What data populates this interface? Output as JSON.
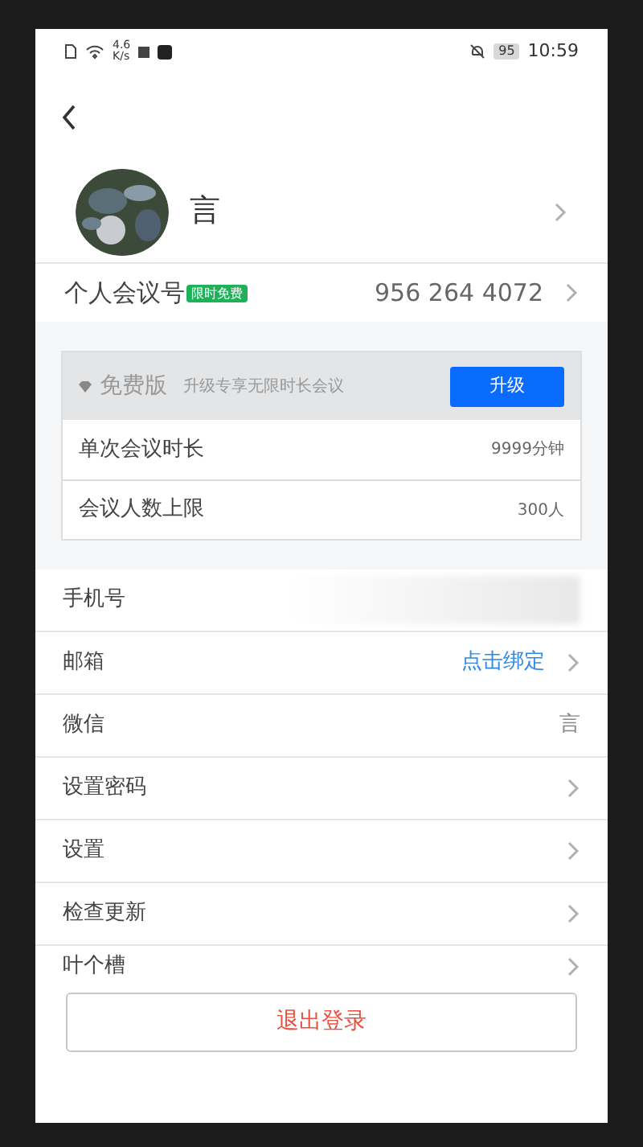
{
  "status_bar": {
    "speed_value": "4.6",
    "speed_unit": "K/s",
    "battery": "95",
    "time": "10:59"
  },
  "profile": {
    "name": "言"
  },
  "meeting_id": {
    "label": "个人会议号",
    "badge": "限时免费",
    "value": "956 264 4072"
  },
  "plan": {
    "name": "免费版",
    "description": "升级专享无限时长会议",
    "upgrade_button": "升级",
    "rows": [
      {
        "label": "单次会议时长",
        "value": "9999分钟"
      },
      {
        "label": "会议人数上限",
        "value": "300人"
      }
    ]
  },
  "settings": [
    {
      "label": "手机号",
      "value_blurred": true,
      "chevron": false
    },
    {
      "label": "邮箱",
      "value": "点击绑定",
      "link": true,
      "chevron": true
    },
    {
      "label": "微信",
      "value": "言",
      "link": false,
      "chevron": false
    },
    {
      "label": "设置密码",
      "chevron": true
    },
    {
      "label": "设置",
      "chevron": true
    },
    {
      "label": "检查更新",
      "chevron": true
    },
    {
      "label": "叶个槽",
      "chevron": true
    }
  ],
  "logout_button": "退出登录"
}
